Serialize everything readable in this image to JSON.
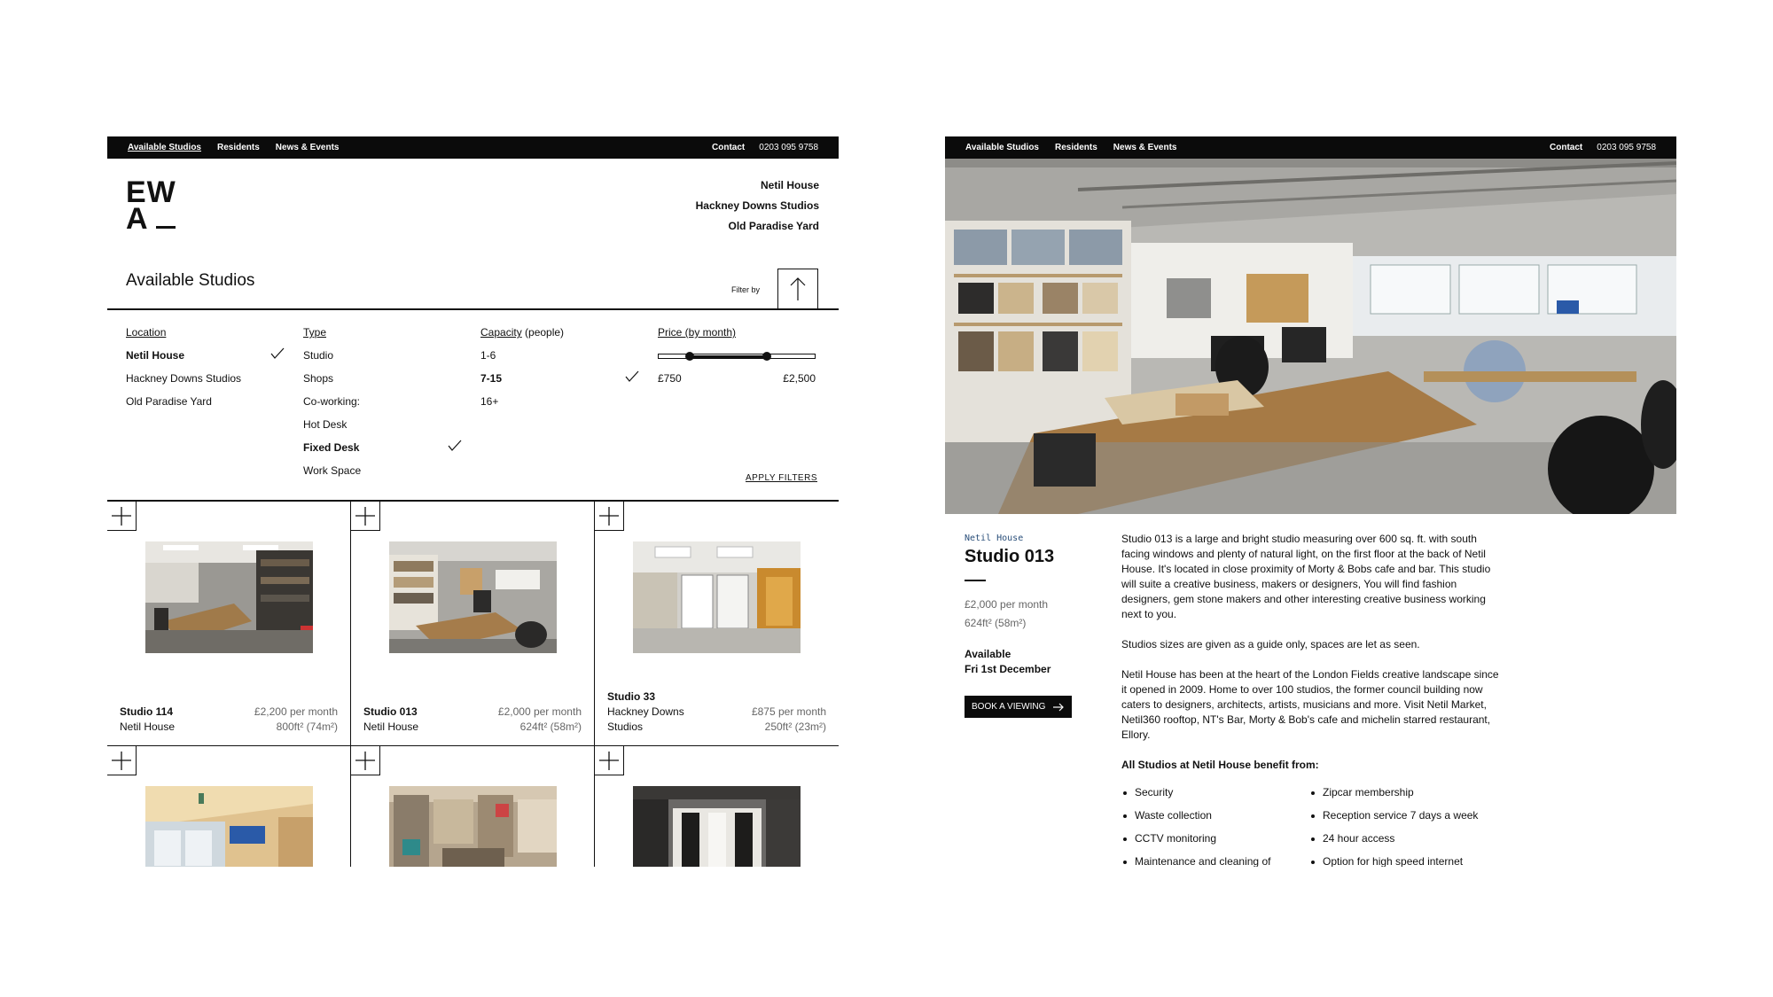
{
  "nav": {
    "available_studios": "Available Studios",
    "residents": "Residents",
    "news_events": "News & Events",
    "contact": "Contact",
    "phone": "0203 095 9758"
  },
  "brand": {
    "line1": "EW",
    "line2": "A"
  },
  "header_locations": [
    "Netil House",
    "Hackney Downs Studios",
    "Old Paradise Yard"
  ],
  "listing": {
    "heading": "Available Studios",
    "filter_by": "Filter by",
    "apply_filters": "APPLY FILTERS"
  },
  "filters": {
    "location": {
      "label": "Location",
      "options": [
        {
          "label": "Netil House",
          "selected": true
        },
        {
          "label": "Hackney Downs Studios",
          "selected": false
        },
        {
          "label": "Old Paradise Yard",
          "selected": false
        }
      ]
    },
    "type": {
      "label": "Type",
      "options": [
        {
          "label": "Studio",
          "selected": false
        },
        {
          "label": "Shops",
          "selected": false
        },
        {
          "label": "Co-working:",
          "selected": false
        },
        {
          "label": "Hot Desk",
          "selected": false
        },
        {
          "label": "Fixed Desk",
          "selected": true
        },
        {
          "label": "Work Space",
          "selected": false
        }
      ]
    },
    "capacity": {
      "label": "Capacity",
      "suffix": " (people)",
      "options": [
        {
          "label": "1-6",
          "selected": false
        },
        {
          "label": "7-15",
          "selected": true
        },
        {
          "label": "16+",
          "selected": false
        }
      ]
    },
    "price": {
      "label": "Price (by month)",
      "min_label": "£750",
      "max_label": "£2,500",
      "low_fraction": 0.2,
      "high_fraction": 0.69
    }
  },
  "studios": [
    {
      "name": "Studio 114",
      "location": "Netil House",
      "price": "£2,200 per month",
      "size": "800ft² (74m²)"
    },
    {
      "name": "Studio 013",
      "location": "Netil House",
      "price": "£2,000 per month",
      "size": "624ft² (58m²)"
    },
    {
      "name": "Studio 33",
      "location": "Hackney Downs Studios",
      "price": "£875 per month",
      "size": "250ft² (23m²)"
    },
    {
      "name": "",
      "location": "",
      "price": "",
      "size": ""
    },
    {
      "name": "",
      "location": "",
      "price": "",
      "size": ""
    },
    {
      "name": "",
      "location": "",
      "price": "",
      "size": ""
    }
  ],
  "detail": {
    "location": "Netil House",
    "name": "Studio 013",
    "price": "£2,000 per month",
    "size": "624ft² (58m²)",
    "availability_label": "Available",
    "availability_date": "Fri 1st December",
    "book_label": "BOOK A VIEWING",
    "paragraphs": [
      "Studio 013 is a large and bright studio measuring over 600 sq. ft. with south facing windows and plenty of natural light, on the first floor at the back of Netil House. It's located in close proximity of Morty & Bobs cafe and bar. This studio will suite a creative business, makers or designers, You will find fashion designers, gem stone makers and other interesting creative business working next to you.",
      "Studios sizes are given as a guide only, spaces are let as seen.",
      "Netil House has been at the heart of the London Fields creative landscape since it opened in 2009. Home to over 100 studios, the former council building now caters to designers, architects, artists, musicians and more. Visit Netil Market, Netil360 rooftop, NT's Bar, Morty & Bob's cafe and michelin starred restaurant, Ellory."
    ],
    "benefits_title": "All Studios at Netil House benefit from:",
    "benefits": [
      "Security",
      "Zipcar membership",
      "Waste collection",
      "Reception service 7 days a week",
      "CCTV monitoring",
      "24 hour access",
      "Maintenance and cleaning of",
      "Option for high speed internet"
    ]
  },
  "icons": {
    "filter_toggle": "arrow-up-icon",
    "selected": "check-icon",
    "expand": "plus-icon",
    "book": "arrow-right-icon"
  }
}
